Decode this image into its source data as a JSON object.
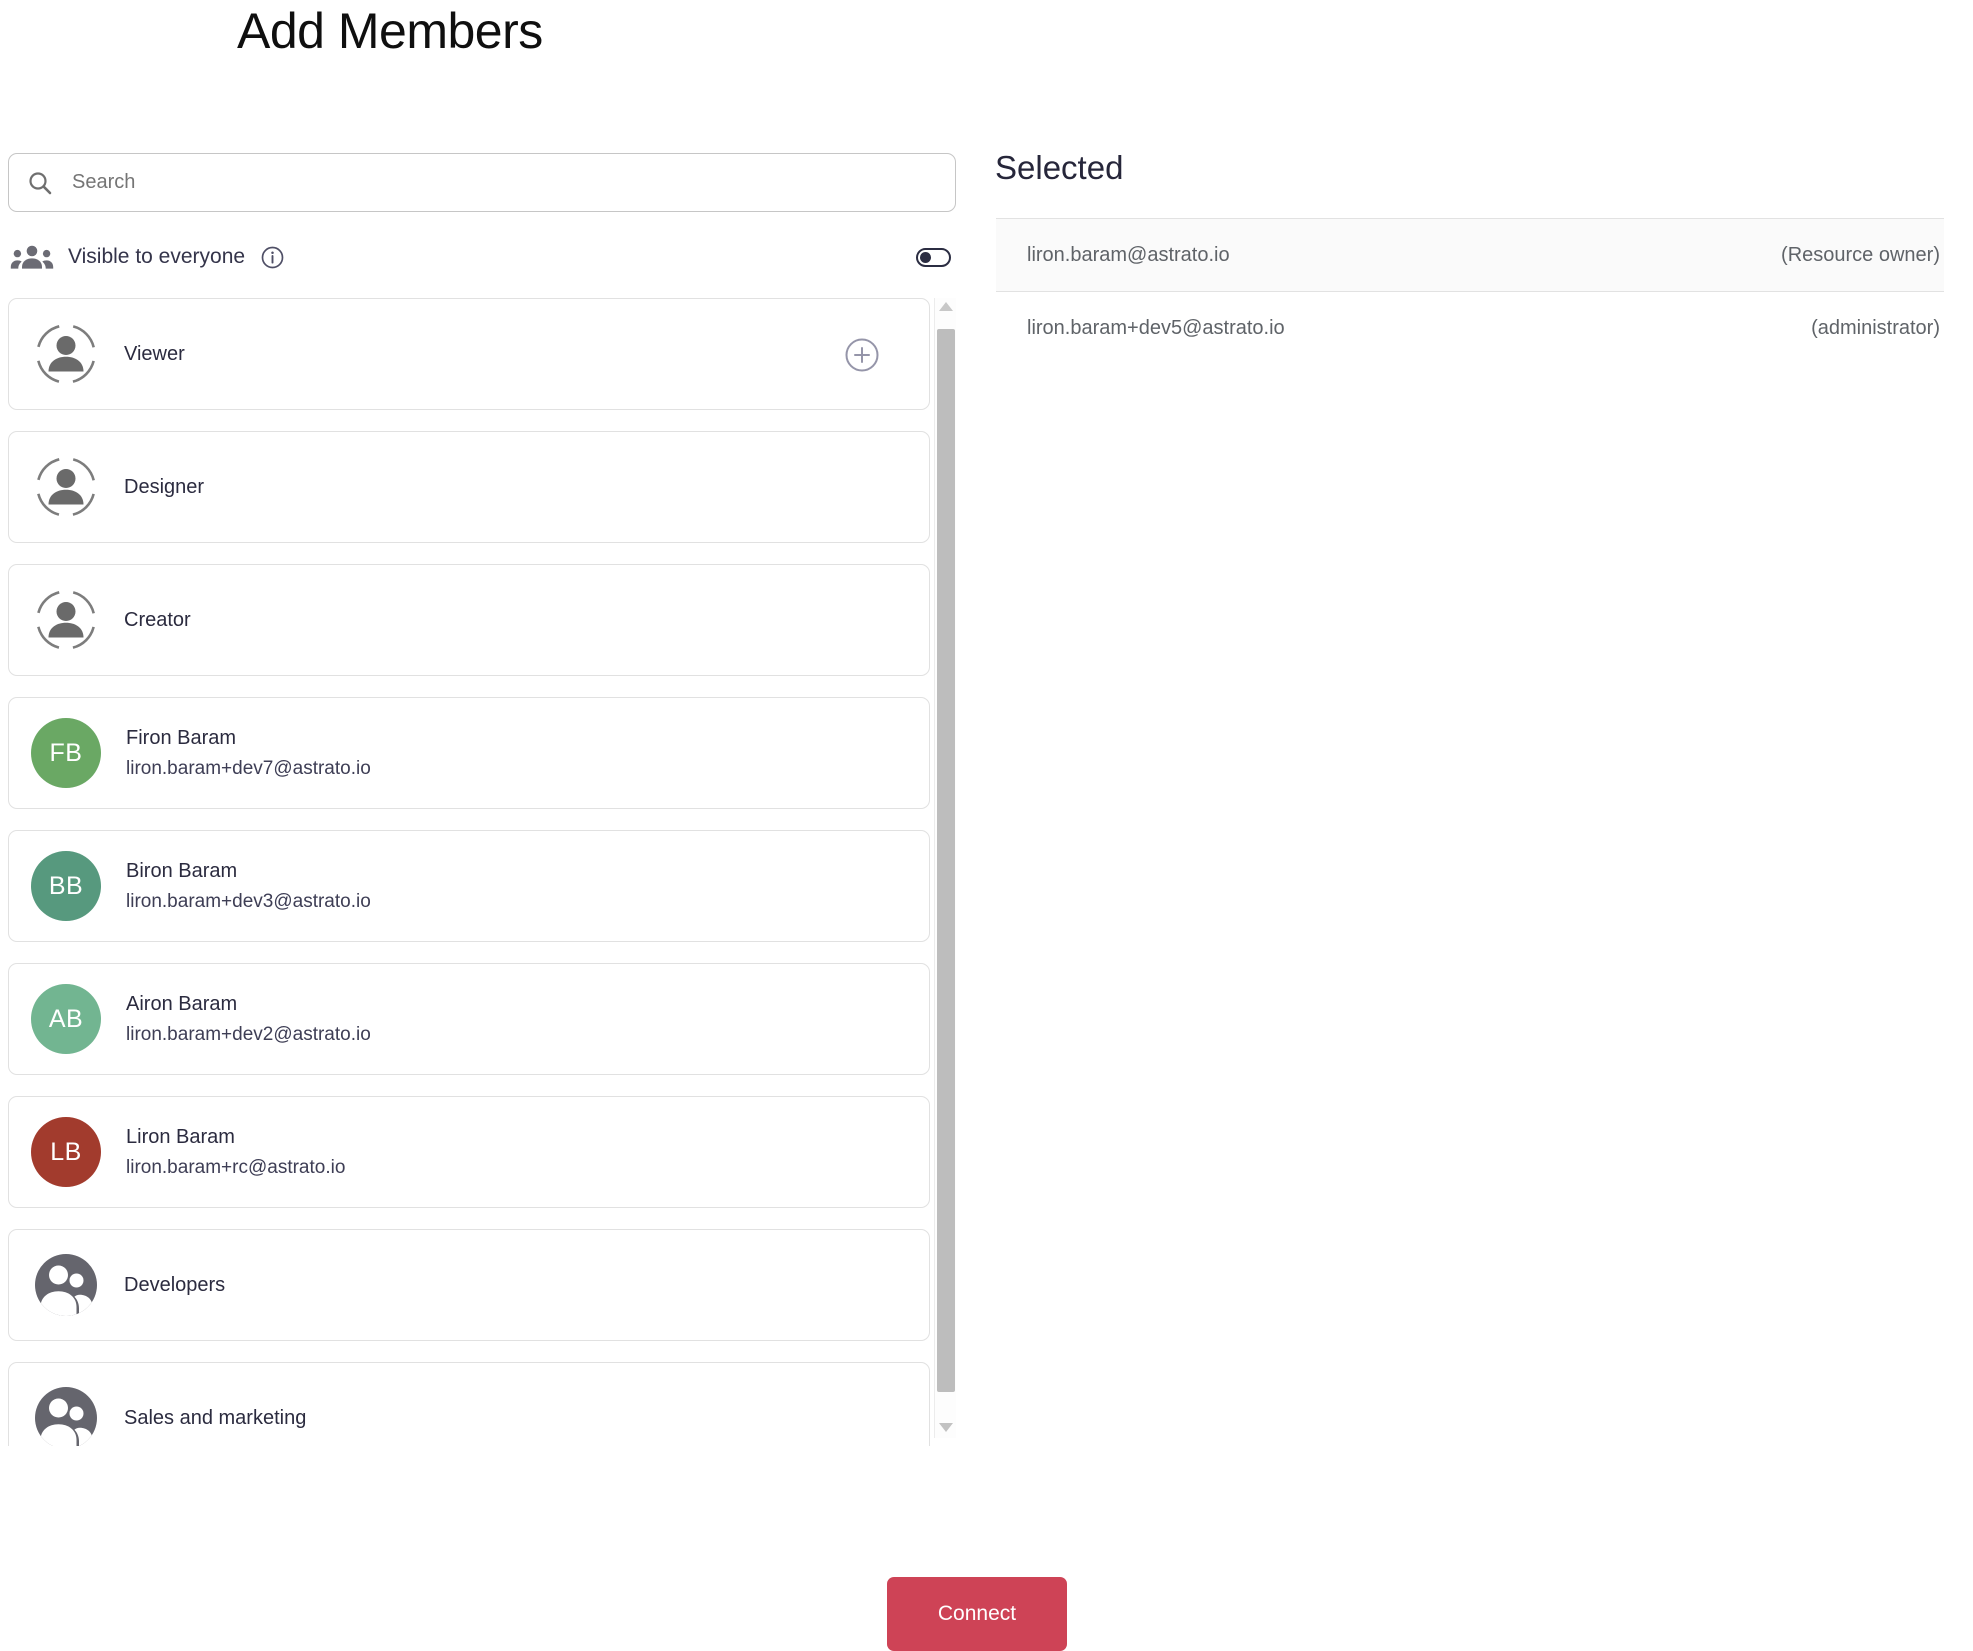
{
  "title": "Add Members",
  "search": {
    "placeholder": "Search"
  },
  "visibility": {
    "label": "Visible to everyone",
    "toggle_on": false
  },
  "members": [
    {
      "type": "role",
      "label": "Viewer",
      "has_add_button": true
    },
    {
      "type": "role",
      "label": "Designer"
    },
    {
      "type": "role",
      "label": "Creator"
    },
    {
      "type": "user",
      "name": "Firon Baram",
      "email": "liron.baram+dev7@astrato.io",
      "initials": "FB",
      "color": "#6aa864"
    },
    {
      "type": "user",
      "name": "Biron Baram",
      "email": "liron.baram+dev3@astrato.io",
      "initials": "BB",
      "color": "#57997e"
    },
    {
      "type": "user",
      "name": "Airon Baram",
      "email": "liron.baram+dev2@astrato.io",
      "initials": "AB",
      "color": "#72b591"
    },
    {
      "type": "user",
      "name": "Liron Baram",
      "email": "liron.baram+rc@astrato.io",
      "initials": "LB",
      "color": "#a23b2d"
    },
    {
      "type": "group",
      "label": "Developers"
    },
    {
      "type": "group",
      "label": "Sales and marketing"
    }
  ],
  "selected": {
    "heading": "Selected",
    "rows": [
      {
        "email": "liron.baram@astrato.io",
        "role": "(Resource owner)"
      },
      {
        "email": "liron.baram+dev5@astrato.io",
        "role": "(administrator)"
      }
    ]
  },
  "footer": {
    "connect_label": "Connect"
  },
  "colors": {
    "accent_red": "#ce4356",
    "toggle": "#2b2d42",
    "card_border": "#e1e1e1",
    "muted_text": "#5f6368",
    "dark_text": "#2b2b3f"
  }
}
